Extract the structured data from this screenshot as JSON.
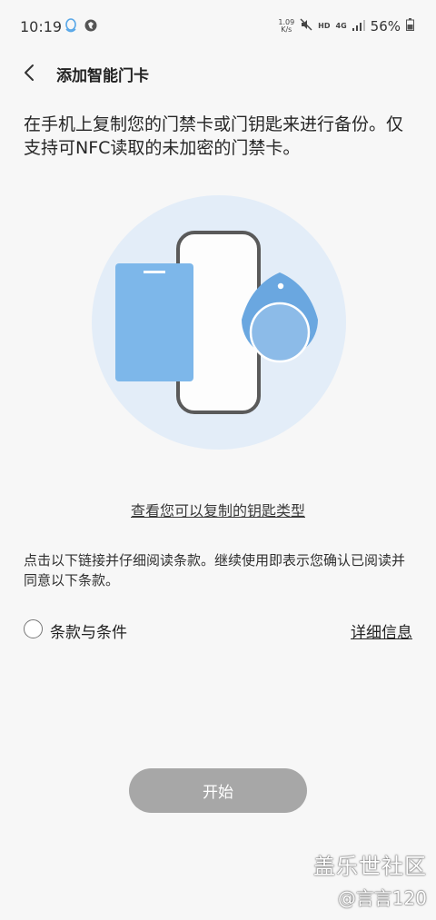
{
  "status_bar": {
    "time": "10:19",
    "speed_value": "1.09",
    "speed_unit": "K/s",
    "hd": "HD",
    "network": "4G",
    "battery": "56%",
    "icons": [
      "qq-icon",
      "vpn-icon",
      "mute-icon",
      "signal-icon",
      "battery-icon"
    ]
  },
  "header": {
    "title": "添加智能门卡"
  },
  "main": {
    "description": "在手机上复制您的门禁卡或门钥匙来进行备份。仅支持可NFC读取的未加密的门禁卡。",
    "key_types_link": "查看您可以复制的钥匙类型",
    "terms_note": "点击以下链接并仔细阅读条款。继续使用即表示您确认已阅读并同意以下条款。",
    "terms_label": "条款与条件",
    "details_link": "详细信息",
    "start_button": "开始"
  },
  "watermark": {
    "brand": "盖乐世社区",
    "user": "@言言120"
  },
  "colors": {
    "background": "#f7f7f7",
    "illustration_circle": "#e3edf8",
    "card_blue": "#7db7ea",
    "fob_blue": "#6aa7e0",
    "button_disabled": "#a7a7a7"
  }
}
